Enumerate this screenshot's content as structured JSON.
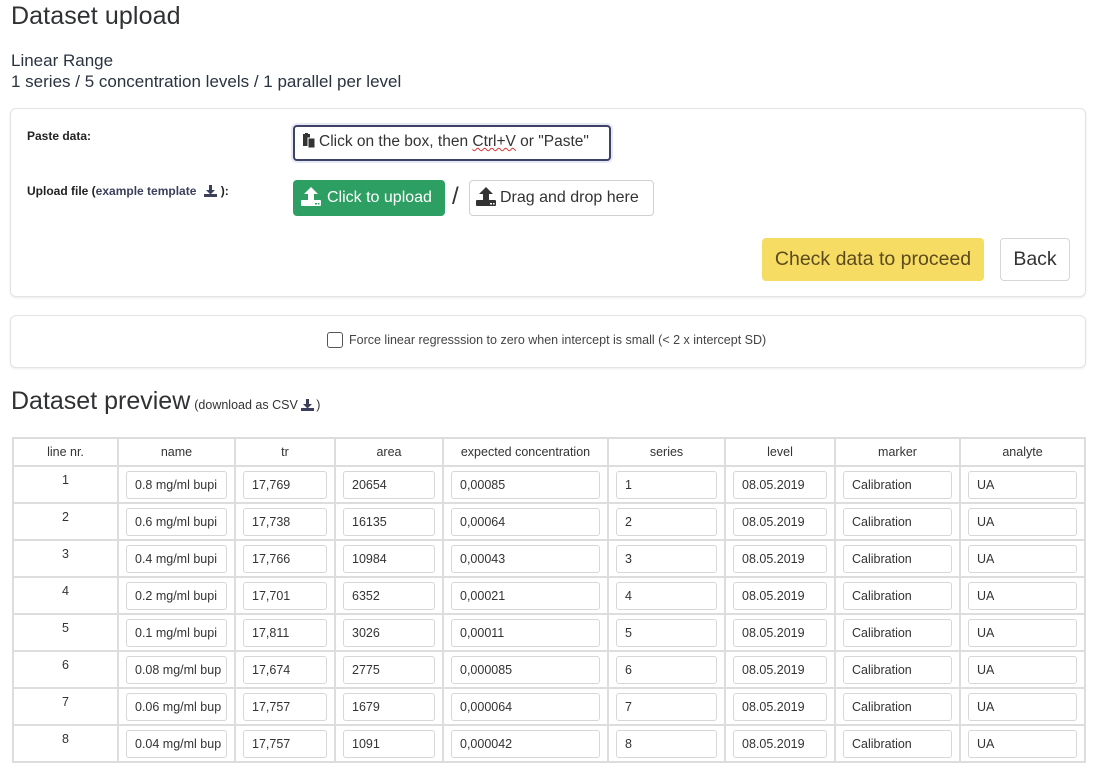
{
  "header": {
    "title": "Dataset upload",
    "subtitle_line1": "Linear Range",
    "subtitle_line2": "1 series / 5 concentration levels / 1 parallel per level"
  },
  "upload": {
    "paste_label": "Paste data:",
    "paste_placeholder_pre": "Click on the box, then ",
    "paste_placeholder_kbd": "Ctrl+V",
    "paste_placeholder_post": " or \"Paste\"",
    "paste_icon": "clipboard-icon",
    "upload_label_pre": "Upload file (",
    "upload_label_link": "example template",
    "upload_label_post": "):",
    "download_icon": "download-icon",
    "click_upload_label": "Click to upload",
    "upload_icon": "upload-icon",
    "separator": "/",
    "drag_drop_label": "Drag and drop here",
    "check_button": "Check data to proceed",
    "back_button": "Back"
  },
  "options": {
    "force_zero_label": "Force linear regresssion to zero when intercept is small (< 2 x intercept SD)",
    "force_zero_checked": false
  },
  "colors": {
    "upload_green": "#2e9f63",
    "check_yellow": "#f7dc63"
  },
  "preview": {
    "title": "Dataset preview",
    "download_pre": "(download as CSV ",
    "download_post": ")",
    "columns": [
      "line nr.",
      "name",
      "tr",
      "area",
      "expected concentration",
      "series",
      "level",
      "marker",
      "analyte"
    ],
    "rows": [
      {
        "line": "1",
        "name": "0.8 mg/ml bupi",
        "tr": "17,769",
        "area": "20654",
        "conc": "0,00085",
        "series": "1",
        "level": "08.05.2019",
        "marker": "Calibration",
        "analyte": "UA"
      },
      {
        "line": "2",
        "name": "0.6 mg/ml bupi",
        "tr": "17,738",
        "area": "16135",
        "conc": "0,00064",
        "series": "2",
        "level": "08.05.2019",
        "marker": "Calibration",
        "analyte": "UA"
      },
      {
        "line": "3",
        "name": "0.4 mg/ml bupi",
        "tr": "17,766",
        "area": "10984",
        "conc": "0,00043",
        "series": "3",
        "level": "08.05.2019",
        "marker": "Calibration",
        "analyte": "UA"
      },
      {
        "line": "4",
        "name": "0.2 mg/ml bupi",
        "tr": "17,701",
        "area": "6352",
        "conc": "0,00021",
        "series": "4",
        "level": "08.05.2019",
        "marker": "Calibration",
        "analyte": "UA"
      },
      {
        "line": "5",
        "name": "0.1 mg/ml bupi",
        "tr": "17,811",
        "area": "3026",
        "conc": "0,00011",
        "series": "5",
        "level": "08.05.2019",
        "marker": "Calibration",
        "analyte": "UA"
      },
      {
        "line": "6",
        "name": "0.08 mg/ml bup",
        "tr": "17,674",
        "area": "2775",
        "conc": "0,000085",
        "series": "6",
        "level": "08.05.2019",
        "marker": "Calibration",
        "analyte": "UA"
      },
      {
        "line": "7",
        "name": "0.06 mg/ml bup",
        "tr": "17,757",
        "area": "1679",
        "conc": "0,000064",
        "series": "7",
        "level": "08.05.2019",
        "marker": "Calibration",
        "analyte": "UA"
      },
      {
        "line": "8",
        "name": "0.04 mg/ml bup",
        "tr": "17,757",
        "area": "1091",
        "conc": "0,000042",
        "series": "8",
        "level": "08.05.2019",
        "marker": "Calibration",
        "analyte": "UA"
      }
    ]
  }
}
